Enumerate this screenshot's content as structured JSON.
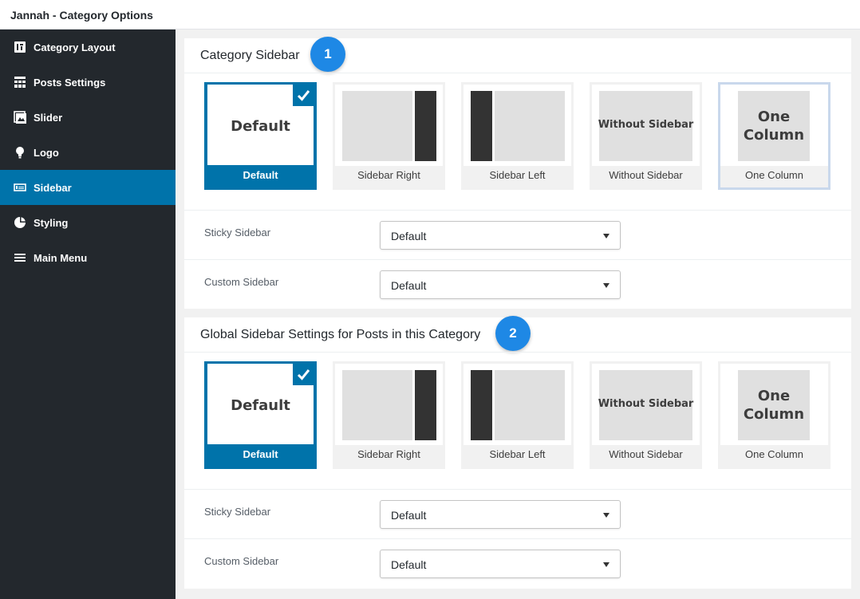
{
  "window": {
    "title": "Jannah - Category Options"
  },
  "sidebar": {
    "items": [
      {
        "label": "Category Layout",
        "icon": "layout-icon",
        "active": false
      },
      {
        "label": "Posts Settings",
        "icon": "grid-icon",
        "active": false
      },
      {
        "label": "Slider",
        "icon": "images-icon",
        "active": false
      },
      {
        "label": "Logo",
        "icon": "lightbulb-icon",
        "active": false
      },
      {
        "label": "Sidebar",
        "icon": "sidebar-icon",
        "active": true
      },
      {
        "label": "Styling",
        "icon": "palette-icon",
        "active": false
      },
      {
        "label": "Main Menu",
        "icon": "menu-icon",
        "active": false
      }
    ]
  },
  "sections": [
    {
      "title": "Category Sidebar",
      "badge": "1",
      "options": [
        {
          "thumb_text": "Default",
          "caption": "Default",
          "selected": true
        },
        {
          "thumb_text": "",
          "caption": "Sidebar Right",
          "selected": false
        },
        {
          "thumb_text": "",
          "caption": "Sidebar Left",
          "selected": false
        },
        {
          "thumb_text": "Without Sidebar",
          "caption": "Without Sidebar",
          "selected": false
        },
        {
          "thumb_text": "One Column",
          "caption": "One Column",
          "selected": false
        }
      ],
      "fields": [
        {
          "label": "Sticky Sidebar",
          "value": "Default"
        },
        {
          "label": "Custom Sidebar",
          "value": "Default"
        }
      ]
    },
    {
      "title": "Global Sidebar Settings for Posts in this Category",
      "badge": "2",
      "options": [
        {
          "thumb_text": "Default",
          "caption": "Default",
          "selected": true
        },
        {
          "thumb_text": "",
          "caption": "Sidebar Right",
          "selected": false
        },
        {
          "thumb_text": "",
          "caption": "Sidebar Left",
          "selected": false
        },
        {
          "thumb_text": "Without Sidebar",
          "caption": "Without Sidebar",
          "selected": false
        },
        {
          "thumb_text": "One Column",
          "caption": "One Column",
          "selected": false
        }
      ],
      "fields": [
        {
          "label": "Sticky Sidebar",
          "value": "Default"
        },
        {
          "label": "Custom Sidebar",
          "value": "Default"
        }
      ]
    }
  ],
  "colors": {
    "accent": "#0073aa",
    "sidebar_bg": "#23282d",
    "badge": "#1e88e5"
  }
}
